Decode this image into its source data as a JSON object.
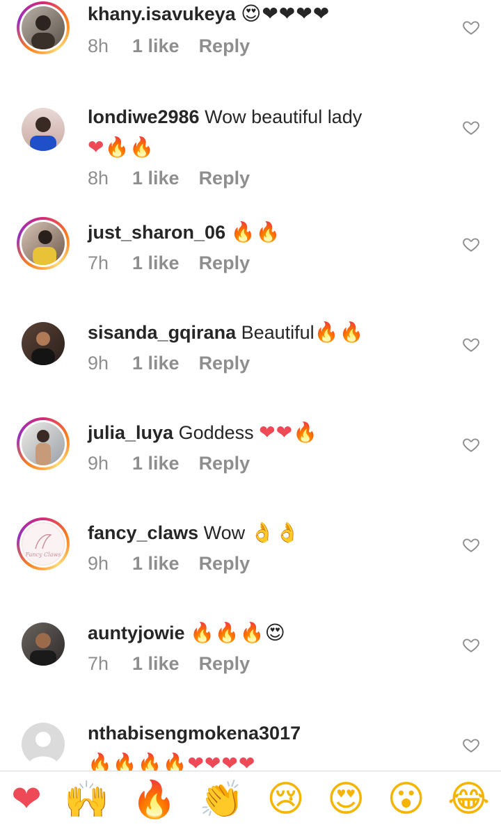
{
  "comments": [
    {
      "username": "khany.isavukeya",
      "text": "",
      "emoji": "😍❤❤❤❤",
      "emoji2": "",
      "time": "8h",
      "likes": "1 like",
      "reply": "Reply"
    },
    {
      "username": "londiwe2986",
      "text": "Wow beautiful lady",
      "emoji": "",
      "emoji2": "❤🔥🔥",
      "time": "8h",
      "likes": "1 like",
      "reply": "Reply"
    },
    {
      "username": "just_sharon_06",
      "text": "",
      "emoji": "🔥🔥",
      "emoji2": "",
      "time": "7h",
      "likes": "1 like",
      "reply": "Reply"
    },
    {
      "username": "sisanda_gqirana",
      "text": "Beautiful",
      "emoji": "🔥🔥",
      "emoji2": "",
      "time": "9h",
      "likes": "1 like",
      "reply": "Reply"
    },
    {
      "username": "julia_luya",
      "text": "Goddess",
      "emoji": "❤❤🔥",
      "emoji2": "",
      "time": "9h",
      "likes": "1 like",
      "reply": "Reply"
    },
    {
      "username": "fancy_claws",
      "text": "Wow",
      "emoji": "👌👌",
      "emoji2": "",
      "time": "9h",
      "likes": "1 like",
      "reply": "Reply",
      "avatar_text": "Fancy Claws"
    },
    {
      "username": "auntyjowie",
      "text": "",
      "emoji": "🔥🔥🔥😍",
      "emoji2": "",
      "time": "7h",
      "likes": "1 like",
      "reply": "Reply"
    },
    {
      "username": "nthabisengmokena3017",
      "text": "",
      "emoji": "",
      "emoji2": "🔥🔥🔥🔥❤❤❤❤",
      "time": "",
      "likes": "",
      "reply": ""
    }
  ],
  "quick_reactions": [
    "❤",
    "🙌",
    "🔥",
    "👏",
    "😢",
    "😍",
    "😮",
    "😂"
  ],
  "colors": {
    "heart": "#ed4956",
    "meta": "#8e8e8e",
    "text": "#262626"
  }
}
